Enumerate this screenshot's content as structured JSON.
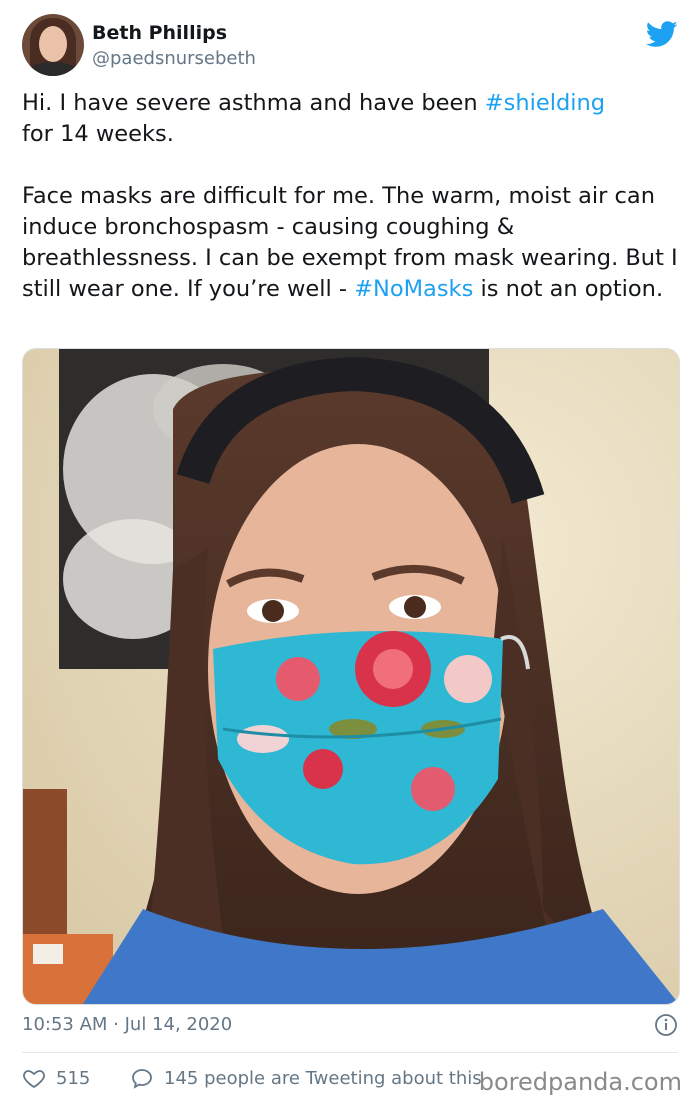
{
  "user": {
    "name": "Beth Phillips",
    "handle": "@paedsnursebeth"
  },
  "tweet": {
    "p1_pre": "Hi. I have severe asthma and have been ",
    "p1_tag": "#shielding",
    "p1_post": " for 14 weeks.",
    "p2_pre": "Face masks are difficult for me. The warm, moist air can induce bronchospasm - causing coughing & breathlessness. I can be exempt from mask wearing. But I still wear one. If you’re well - ",
    "p2_tag": "#NoMasks",
    "p2_post": " is not an option."
  },
  "meta": {
    "timestamp": "10:53 AM · Jul 14, 2020"
  },
  "actions": {
    "likes": "515",
    "tweeting": "145 people are Tweeting about this"
  },
  "watermark": "boredpanda.com",
  "colors": {
    "accent": "#1da1f2",
    "muted": "#657786"
  },
  "icons": [
    "twitter-bird-icon",
    "info-icon",
    "heart-icon",
    "reply-icon"
  ]
}
